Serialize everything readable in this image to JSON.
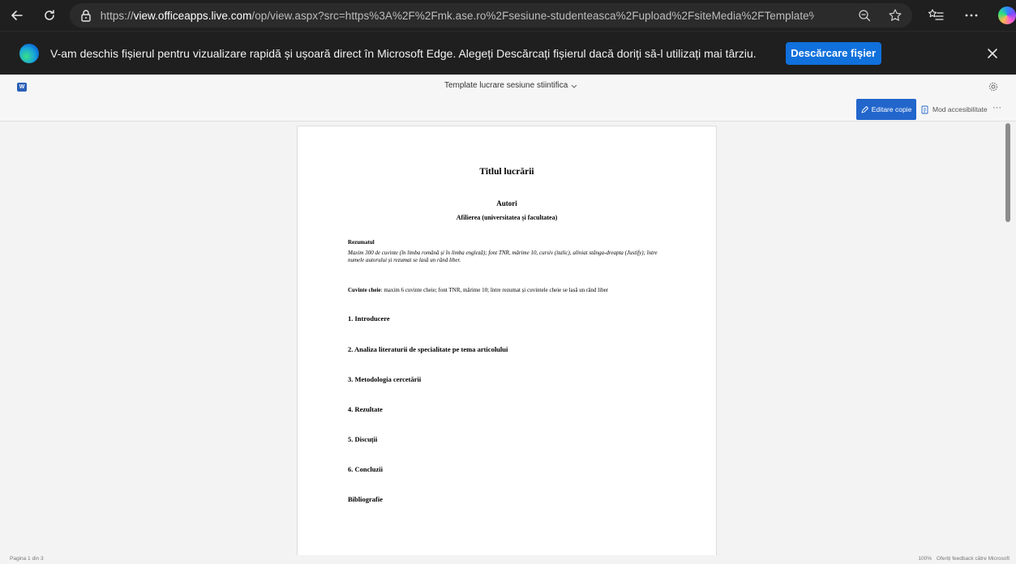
{
  "browser": {
    "url_scheme": "https://",
    "url_host": "view.officeapps.live.com",
    "url_path": "/op/view.aspx?src=https%3A%2F%2Fmk.ase.ro%2Fsesiune-studenteasca%2Fupload%2FsiteMedia%2FTemplate%..."
  },
  "infobar": {
    "message": "V-am deschis fișierul pentru vizualizare rapidă și ușoară direct în Microsoft Edge. Alegeți Descărcați fișierul dacă doriți să-l utilizați mai târziu.",
    "download_label": "Descărcare fișier"
  },
  "office": {
    "app_icon_letter": "W",
    "doc_title": "Template lucrare sesiune stiintifica",
    "edit_copy_label": "Editare copie",
    "accessibility_label": "Mod accesibilitate",
    "more_label": "···"
  },
  "document": {
    "title": "Titlul lucrării",
    "authors": "Autori",
    "affiliation": "Afilierea (universitatea și facultatea)",
    "abstract_title": "Rezumatul",
    "abstract_text": "Maxim 300 de cuvinte (în limba română și în limba engleză); font TNR, mărime 10, cursiv (italic), aliniat stânga-dreapta (Justify); între numele autorului și rezumat se lasă un rând liber.",
    "keywords_label": "Cuvinte cheie",
    "keywords_text": ": maxim 6 cuvinte cheie; font TNR, mărime 10; între rezumat și cuvintele cheie se lasă un rând liber",
    "sections": [
      "1. Introducere",
      "2. Analiza literaturii de specialitate pe tema articolului",
      "3. Metodologia cercetării",
      "4. Rezultate",
      "5. Discuții",
      "6. Concluzii",
      "Bibliografie"
    ]
  },
  "status": {
    "page_count": "Pagina 1 din 3",
    "zoom": "100%",
    "feedback": "Oferiți feedback către Microsoft"
  },
  "colors": {
    "accent": "#1070dc",
    "edit_button": "#2266cc",
    "browser_chrome": "#1f1f1f"
  }
}
